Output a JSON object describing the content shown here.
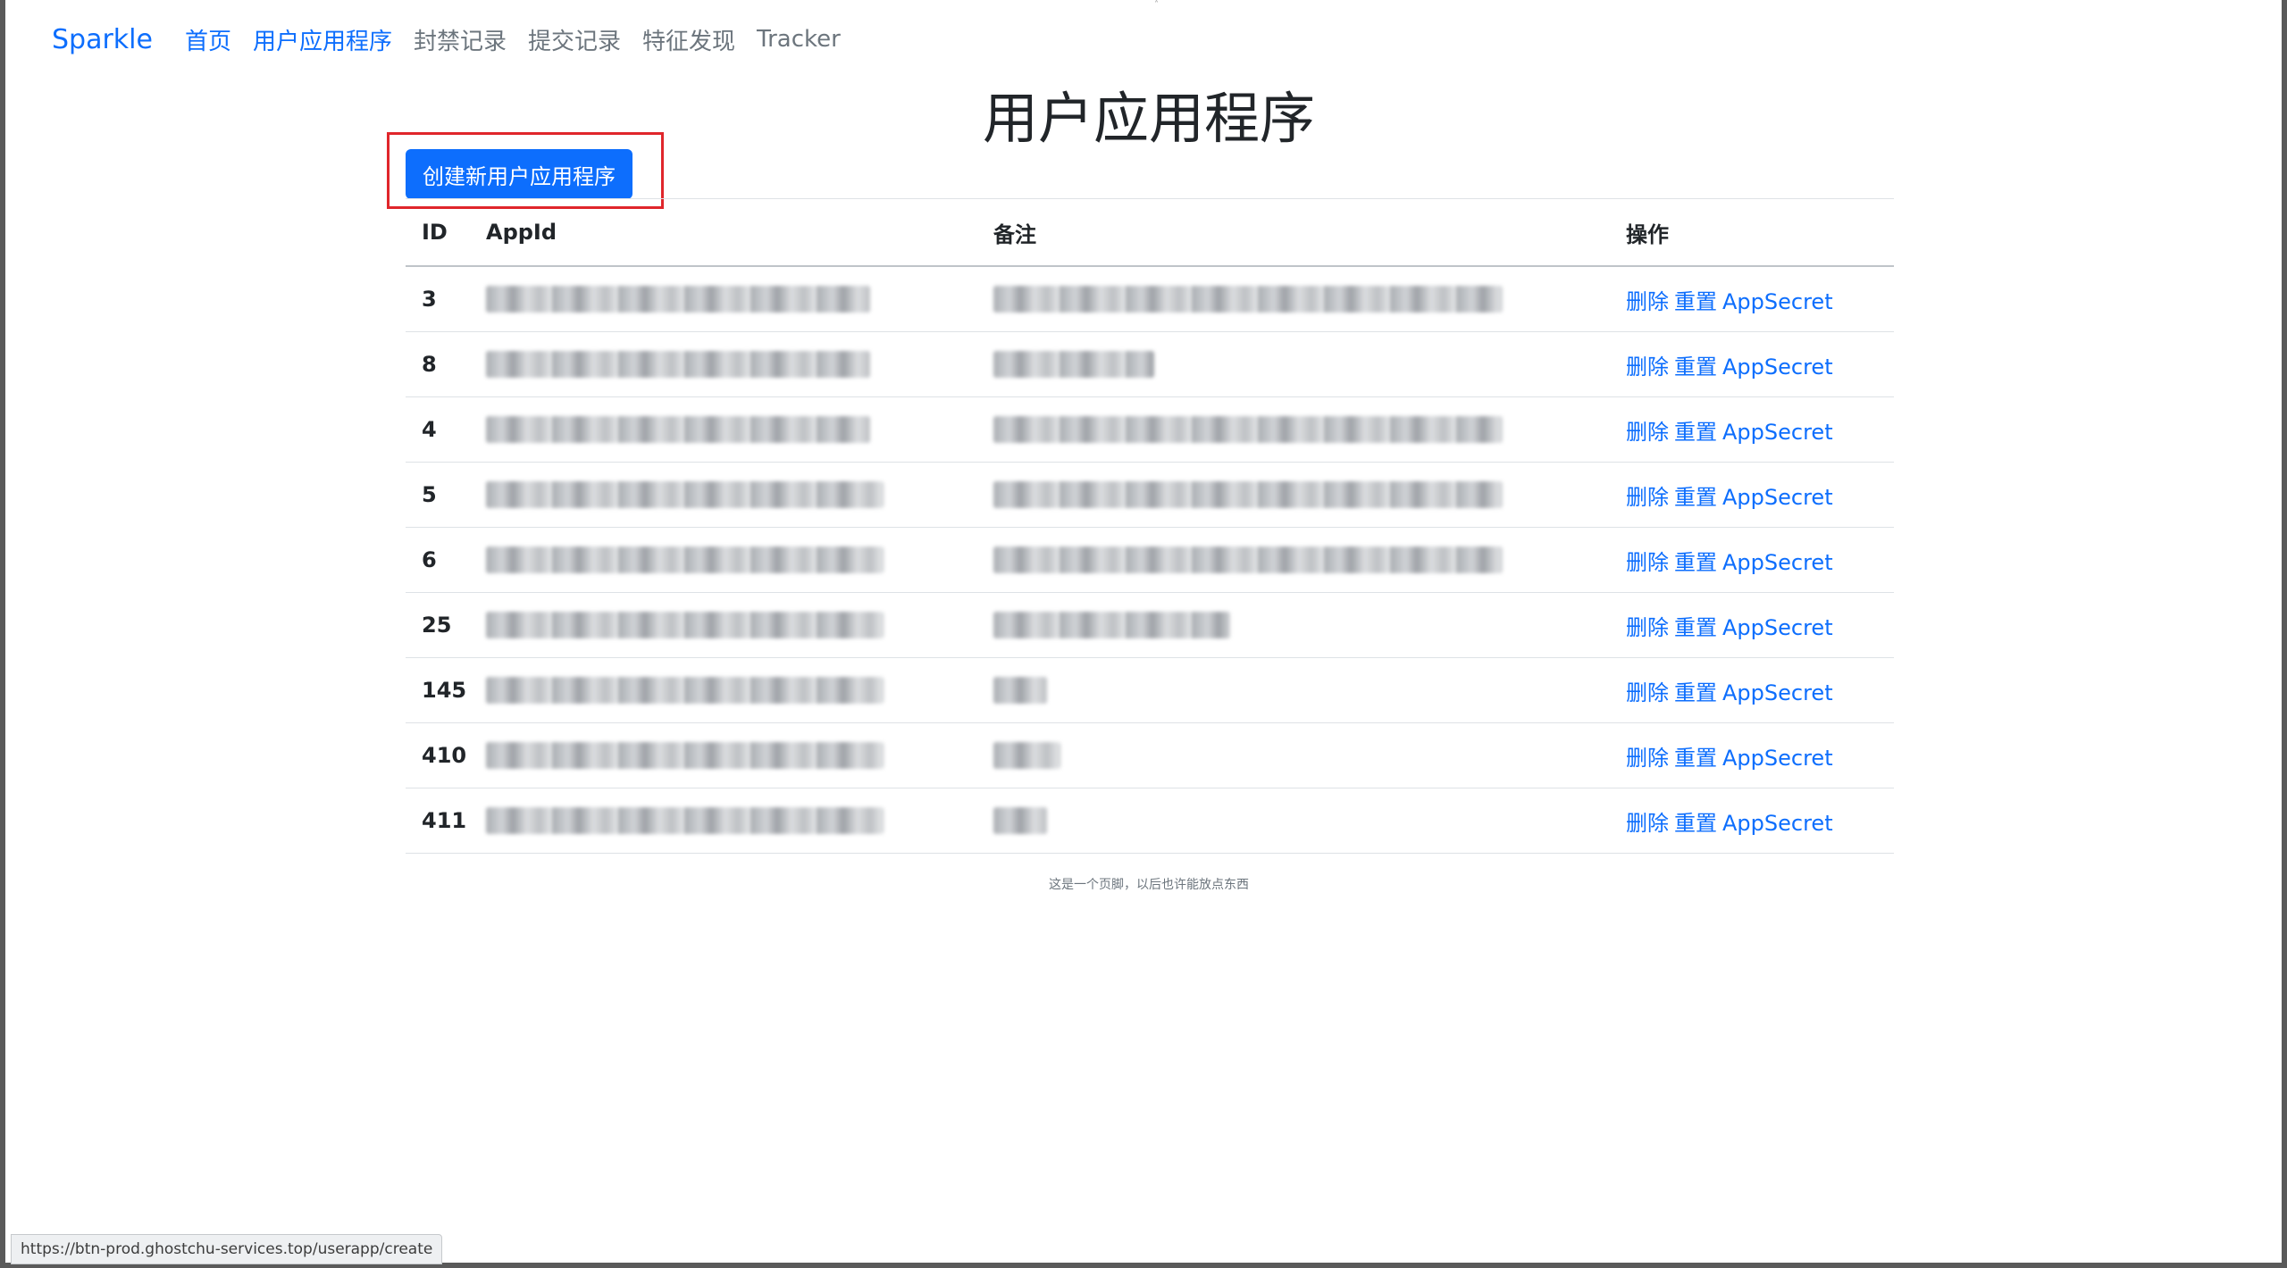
{
  "navbar": {
    "brand": "Sparkle",
    "items": [
      {
        "label": "首页",
        "state": "link"
      },
      {
        "label": "用户应用程序",
        "state": "active"
      },
      {
        "label": "封禁记录",
        "state": "inactive"
      },
      {
        "label": "提交记录",
        "state": "inactive"
      },
      {
        "label": "特征发现",
        "state": "inactive"
      },
      {
        "label": "Tracker",
        "state": "inactive"
      }
    ]
  },
  "page": {
    "title": "用户应用程序",
    "create_button": "创建新用户应用程序"
  },
  "table": {
    "headers": {
      "id": "ID",
      "appid": "AppId",
      "note": "备注",
      "action": "操作"
    },
    "actions": {
      "delete": "删除",
      "reset": "重置",
      "secret": "AppSecret"
    },
    "rows": [
      {
        "id": "3"
      },
      {
        "id": "8"
      },
      {
        "id": "4"
      },
      {
        "id": "5"
      },
      {
        "id": "6"
      },
      {
        "id": "25"
      },
      {
        "id": "145"
      },
      {
        "id": "410"
      },
      {
        "id": "411"
      }
    ]
  },
  "footer": {
    "text": "这是一个页脚，以后也许能放点东西"
  },
  "status_bar": {
    "url": "https://btn-prod.ghostchu-services.top/userapp/create"
  },
  "colors": {
    "primary": "#0d6efd",
    "muted": "#6c757d",
    "highlight": "#e0262b"
  }
}
